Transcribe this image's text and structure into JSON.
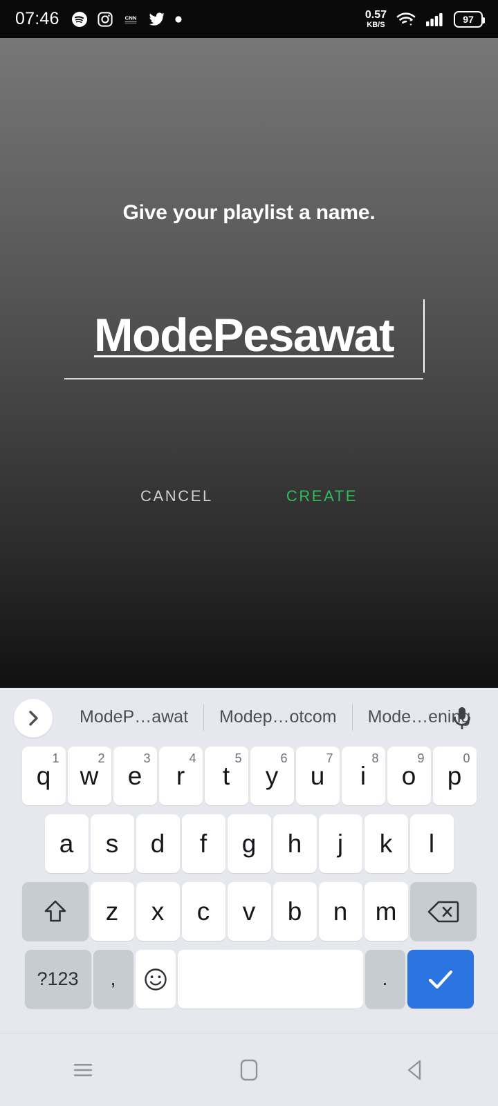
{
  "status_bar": {
    "clock": "07:46",
    "app_icons": [
      "spotify-icon",
      "instagram-icon",
      "cnn-icon",
      "twitter-icon",
      "dot-icon"
    ],
    "network_speed_value": "0.57",
    "network_speed_unit": "KB/S",
    "wifi_icon": "wifi-icon",
    "signal_icon": "cellular-signal-icon",
    "battery_level": "97"
  },
  "dialog": {
    "title": "Give your playlist a name.",
    "playlist_name_value": "ModePesawat",
    "playlist_name_placeholder": "",
    "cancel_label": "CANCEL",
    "create_label": "CREATE",
    "create_color": "#2ebd59",
    "cancel_color": "#d0d0d0"
  },
  "keyboard": {
    "expand_icon": "chevron-right-icon",
    "mic_icon": "microphone-icon",
    "suggestions": [
      "ModeP…awat",
      "Modep…otcom",
      "Mode…ening"
    ],
    "row1": [
      {
        "label": "q",
        "sup": "1"
      },
      {
        "label": "w",
        "sup": "2"
      },
      {
        "label": "e",
        "sup": "3"
      },
      {
        "label": "r",
        "sup": "4"
      },
      {
        "label": "t",
        "sup": "5"
      },
      {
        "label": "y",
        "sup": "6"
      },
      {
        "label": "u",
        "sup": "7"
      },
      {
        "label": "i",
        "sup": "8"
      },
      {
        "label": "o",
        "sup": "9"
      },
      {
        "label": "p",
        "sup": "0"
      }
    ],
    "row2": [
      {
        "label": "a"
      },
      {
        "label": "s"
      },
      {
        "label": "d"
      },
      {
        "label": "f"
      },
      {
        "label": "g"
      },
      {
        "label": "h"
      },
      {
        "label": "j"
      },
      {
        "label": "k"
      },
      {
        "label": "l"
      }
    ],
    "row3": [
      {
        "label": "z"
      },
      {
        "label": "x"
      },
      {
        "label": "c"
      },
      {
        "label": "v"
      },
      {
        "label": "b"
      },
      {
        "label": "n"
      },
      {
        "label": "m"
      }
    ],
    "shift_icon": "shift-icon",
    "backspace_icon": "backspace-icon",
    "symbols_label": "?123",
    "comma_label": ",",
    "emoji_icon": "emoji-smiley-icon",
    "space_label": "",
    "period_label": ".",
    "enter_icon": "checkmark-icon",
    "enter_color": "#2b75e0"
  },
  "nav_bar": {
    "recents_icon": "recents-menu-icon",
    "home_icon": "home-square-icon",
    "back_icon": "back-triangle-icon"
  }
}
